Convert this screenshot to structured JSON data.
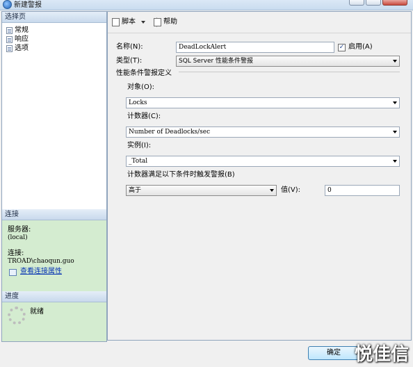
{
  "window": {
    "title": "新建警报"
  },
  "sidebar": {
    "select_page_header": "选择页",
    "pages": [
      {
        "label": "常规"
      },
      {
        "label": "响应"
      },
      {
        "label": "选项"
      }
    ],
    "connection": {
      "header": "连接",
      "server_label": "服务器:",
      "server_value": "(local)",
      "connect_label": "连接:",
      "connect_value": "TROAD\\chaoqun.guo",
      "link_text": "查看连接属性"
    },
    "progress": {
      "header": "进度",
      "status": "就绪"
    }
  },
  "toolbar": {
    "script_label": "脚本",
    "help_label": "帮助"
  },
  "form": {
    "name_label": "名称(N):",
    "name_value": "DeadLockAlert",
    "enabled_label": "启用(A)",
    "enabled_checked": true,
    "type_label": "类型(T):",
    "type_value": "SQL Server 性能条件警报",
    "perf_group_label": "性能条件警报定义",
    "object_label": "对象(O):",
    "object_value": "Locks",
    "counter_label": "计数器(C):",
    "counter_value": "Number of Deadlocks/sec",
    "instance_label": "实例(I):",
    "instance_value": "_Total",
    "condition_label": "计数器满足以下条件时触发警报(B)",
    "condition_value": "高于",
    "value_label": "值(V):",
    "value_value": "0"
  },
  "footer": {
    "ok_label": "确定",
    "watermark": "悦佳信"
  }
}
